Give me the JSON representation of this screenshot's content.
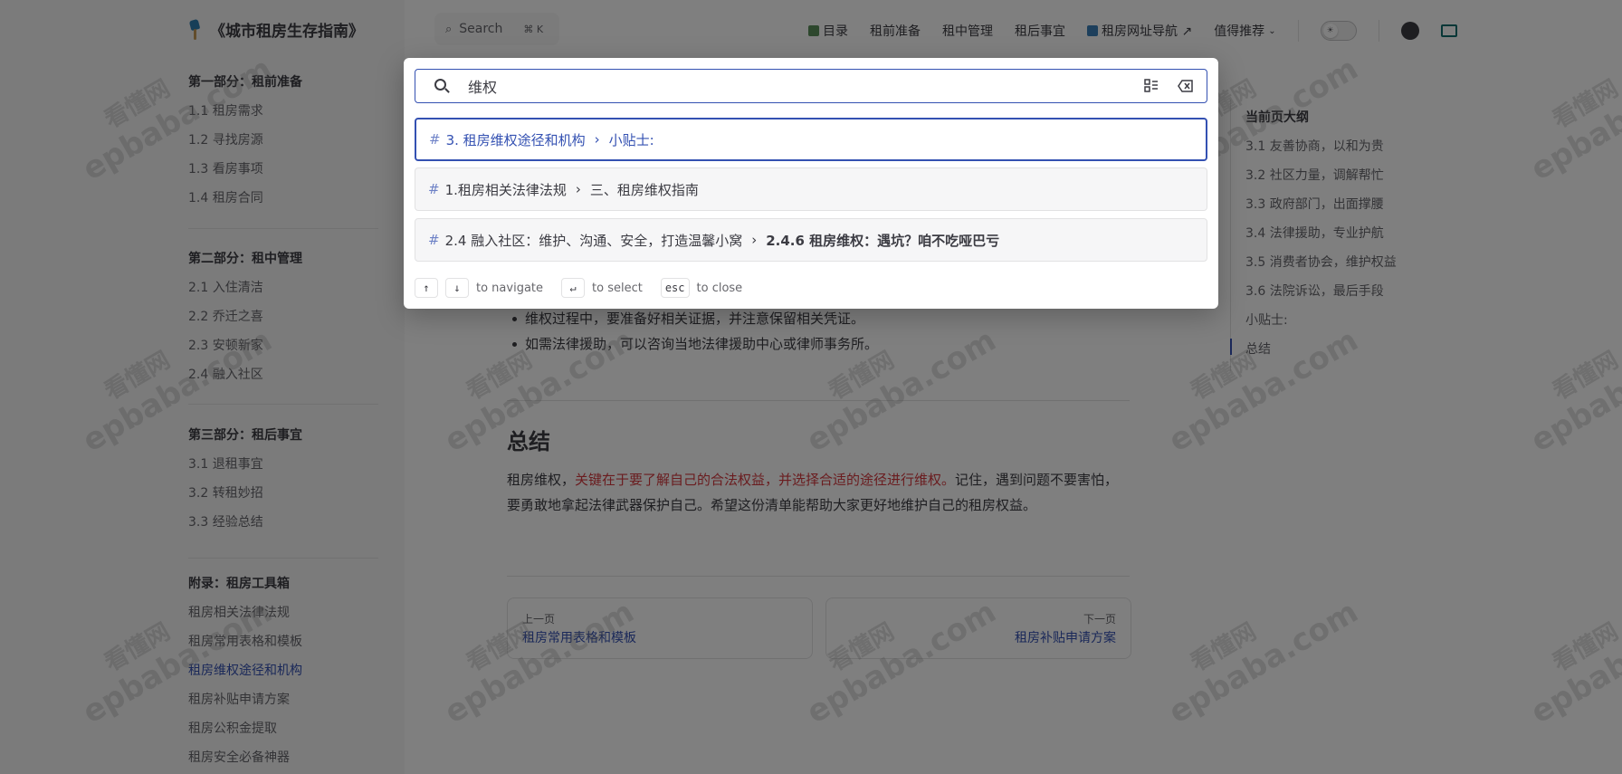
{
  "header": {
    "site_title": "《城市租房生存指南》",
    "search_label": "Search",
    "search_shortcut": "⌘ K",
    "nav": [
      {
        "label": "目录"
      },
      {
        "label": "租前准备"
      },
      {
        "label": "租中管理"
      },
      {
        "label": "租后事宜"
      },
      {
        "label": "租房网址导航 ↗"
      },
      {
        "label": "值得推荐"
      }
    ]
  },
  "sidebar": {
    "groups": [
      {
        "title": "第一部分：租前准备",
        "items": [
          "1.1 租房需求",
          "1.2 寻找房源",
          "1.3 看房事项",
          "1.4 租房合同"
        ]
      },
      {
        "title": "第二部分：租中管理",
        "items": [
          "2.1 入住清洁",
          "2.2 乔迁之喜",
          "2.3 安顿新家",
          "2.4 融入社区"
        ]
      },
      {
        "title": "第三部分：租后事宜",
        "items": [
          "3.1 退租事宜",
          "3.2 转租妙招",
          "3.3 经验总结"
        ]
      },
      {
        "title": "附录：租房工具箱",
        "items": [
          "租房相关法律法规",
          "租房常用表格和模板",
          "租房维权途径和机构",
          "租房补贴申请方案",
          "租房公积金提取",
          "租房安全必备神器"
        ]
      }
    ],
    "active_item": "租房维权途径和机构"
  },
  "content": {
    "bullets": [
      "维权过程中，要准备好相关证据，并注意保留相关凭证。",
      "如需法律援助，可以咨询当地法律援助中心或律师事务所。"
    ],
    "heading": "总结",
    "para_pre": "租房维权，",
    "para_hl": "关键在于要了解自己的合法权益，并选择合适的途径进行维权。",
    "para_post": "记住，遇到问题不要害怕，要勇敢地拿起法律武器保护自己。希望这份清单能帮助大家更好地维护自己的租房权益。",
    "prev_caption": "上一页",
    "prev_title": "租房常用表格和模板",
    "next_caption": "下一页",
    "next_title": "租房补贴申请方案"
  },
  "outline": {
    "title": "当前页大纲",
    "items": [
      "3.1 友善协商，以和为贵",
      "3.2 社区力量，调解帮忙",
      "3.3 政府部门，出面撑腰",
      "3.4 法律援助，专业护航",
      "3.5 消费者协会，维护权益",
      "3.6 法院诉讼，最后手段",
      "小贴士:",
      "总结"
    ]
  },
  "watermark": {
    "site": "epbaba.com",
    "cn": "看懂网"
  },
  "search_modal": {
    "query": "维权",
    "results": [
      {
        "hash": "#",
        "path": "3. 租房维权途径和机构",
        "title": "小贴士:"
      },
      {
        "hash": "#",
        "path": "1.租房相关法律法规",
        "title": "三、租房维权指南"
      },
      {
        "hash": "#",
        "path": "2.4 融入社区：维护、沟通、安全，打造温馨小窝",
        "title": "2.4.6 租房维权：遇坑？咱不吃哑巴亏"
      }
    ],
    "footer": {
      "navigate": "to navigate",
      "select": "to select",
      "close_key": "esc",
      "close": "to close"
    }
  },
  "colors": {
    "brand": "#3451b2",
    "highlight": "#d5393e"
  }
}
